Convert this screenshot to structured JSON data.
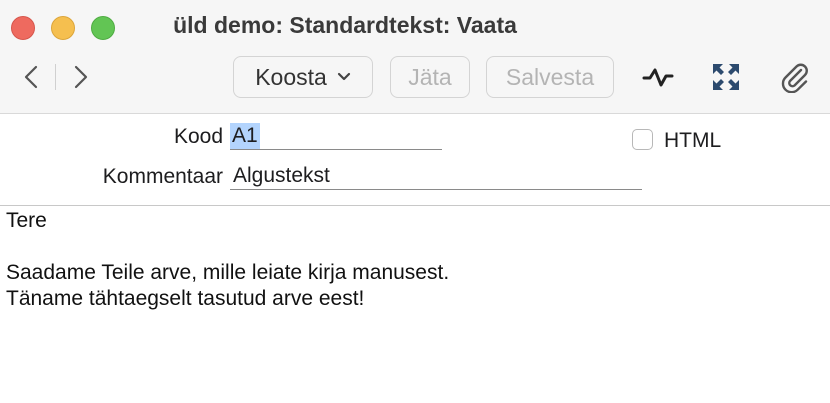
{
  "window": {
    "title": "üld demo: Standardtekst: Vaata"
  },
  "toolbar": {
    "back_icon": "chevron-left-icon",
    "forward_icon": "chevron-right-icon",
    "koosta_label": "Koosta",
    "jata_label": "Jäta",
    "salvesta_label": "Salvesta",
    "activity_icon": "activity-graph-icon",
    "expand_icon": "expand-arrows-icon",
    "attach_icon": "paperclip-icon"
  },
  "form": {
    "kood_label": "Kood",
    "kood_value": "A1",
    "kommentaar_label": "Kommentaar",
    "kommentaar_value": "Algustekst",
    "html_label": "HTML",
    "html_checked": false
  },
  "body": {
    "lines": [
      "Tere",
      "",
      "Saadame Teile arve, mille leiate kirja manusest.",
      "Täname tähtaegselt tasutud arve eest!"
    ]
  },
  "colors": {
    "close": "#ee6a5f",
    "minimize": "#f5bf4f",
    "zoom": "#62c554",
    "selection": "#b3d4fd"
  }
}
